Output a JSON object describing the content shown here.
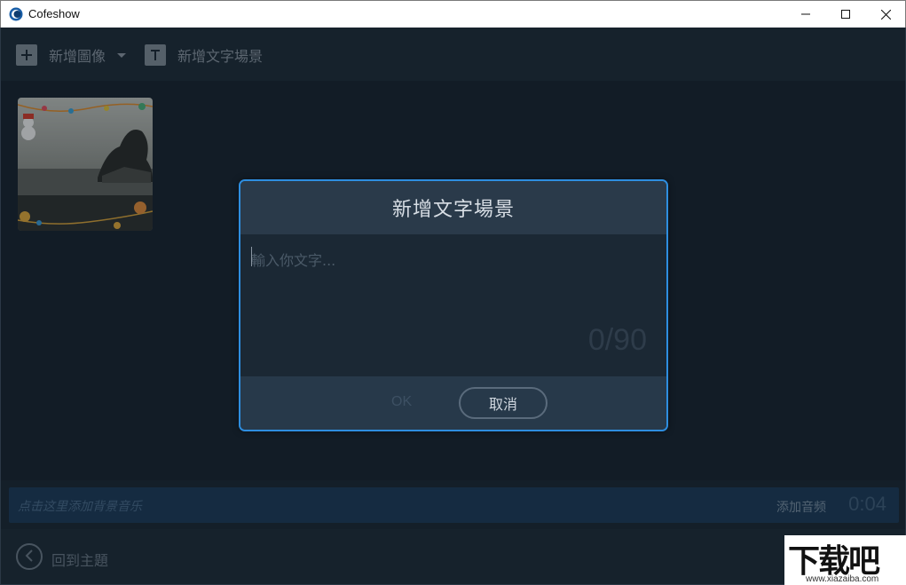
{
  "window": {
    "title": "Cofeshow"
  },
  "toolbar": {
    "add_image_label": "新增圖像",
    "add_text_scene_label": "新增文字場景"
  },
  "music": {
    "placeholder": "点击这里添加背景音乐",
    "add_label": "添加音频",
    "duration": "0:04"
  },
  "footer": {
    "back_label": "回到主題"
  },
  "dialog": {
    "title": "新增文字場景",
    "input_placeholder": "輸入你文字...",
    "char_count": "0/90",
    "ok_label": "OK",
    "cancel_label": "取消"
  },
  "watermark": {
    "main": "下载吧",
    "sub": "www.xiazaiba.com"
  },
  "colors": {
    "accent": "#2e8ee0",
    "app_bg": "#1b2734",
    "music_bar": "#1c3a58"
  }
}
